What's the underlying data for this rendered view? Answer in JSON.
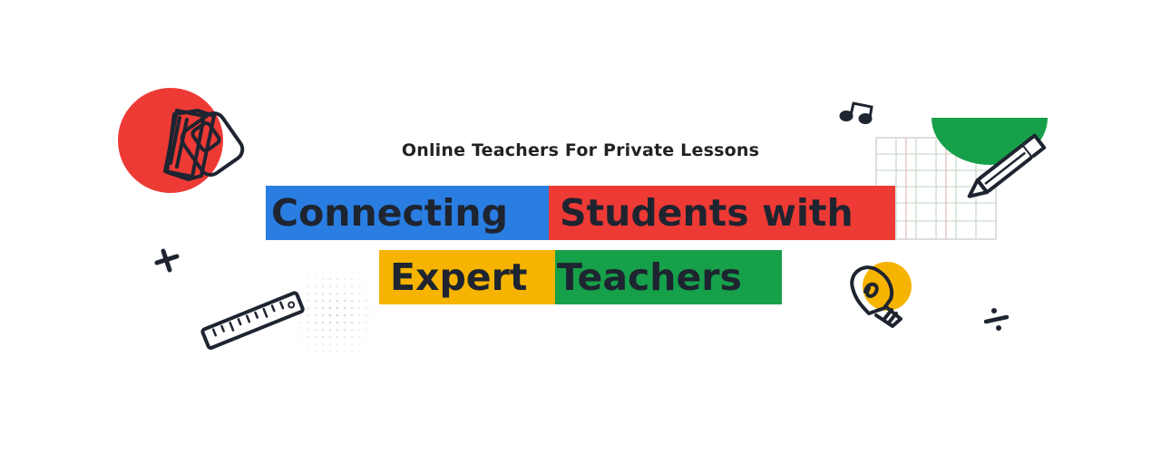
{
  "banner": {
    "subtitle": "Online Teachers For Private Lessons",
    "headline": [
      {
        "text": "Connecting",
        "color": "#2a7de1"
      },
      {
        "text": "Students with",
        "color": "#ee3a35"
      },
      {
        "text": "Expert",
        "color": "#f6b400"
      },
      {
        "text": "Teachers",
        "color": "#17a04a"
      }
    ]
  },
  "decorations": {
    "icons": [
      "red-circle",
      "book-icon",
      "eraser-icon",
      "music-note-icon",
      "green-half-circle",
      "grid-paper",
      "pencil-icon",
      "plus-sign-icon",
      "ruler-icon",
      "dot-pattern",
      "lightbulb-icon",
      "divide-sign-icon"
    ],
    "colors": {
      "red": "#ee3a35",
      "green": "#17a04a",
      "yellow": "#f6b400",
      "ink": "#1e2430"
    }
  }
}
